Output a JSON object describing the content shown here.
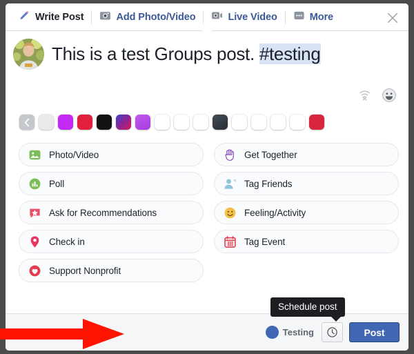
{
  "window": {
    "backdrop_color": "#4b4b4b",
    "surface_color": "#ffffff"
  },
  "tabs": [
    {
      "label": "Write Post",
      "icon": "pencil-icon",
      "active": true
    },
    {
      "label": "Add Photo/Video",
      "icon": "camera-icon",
      "active": false
    },
    {
      "label": "Live Video",
      "icon": "video-camera-icon",
      "active": false
    },
    {
      "label": "More",
      "icon": "ellipsis-icon",
      "active": false
    }
  ],
  "close_label": "×",
  "composer": {
    "avatar_name": "user-avatar",
    "text_plain": "This is a test Groups post. ",
    "text_hashtag": "#testing",
    "hashtag_highlight_color": "#d8e3f7",
    "utility_icons": [
      {
        "name": "live-off-icon"
      },
      {
        "name": "emoji-smiley-icon"
      }
    ]
  },
  "swatches": [
    {
      "name": "back-arrow",
      "type": "back",
      "color": "#c4c7cb"
    },
    {
      "name": "swatch-white-gray",
      "type": "solid",
      "color": "#e9eaec"
    },
    {
      "name": "swatch-magenta",
      "type": "solid",
      "color": "#c229f2"
    },
    {
      "name": "swatch-red",
      "type": "solid",
      "color": "#e0203c"
    },
    {
      "name": "swatch-black",
      "type": "solid",
      "color": "#121212"
    },
    {
      "name": "swatch-blue-pink-gradient",
      "type": "gradient",
      "color": "#4040c8",
      "color2": "#d1195e"
    },
    {
      "name": "swatch-purple-gradient",
      "type": "gradient",
      "color": "#b84ae8",
      "color2": "#c45bf0"
    },
    {
      "name": "swatch-plain-1",
      "type": "solid",
      "color": "#ffffff"
    },
    {
      "name": "swatch-plain-2",
      "type": "solid",
      "color": "#ffffff"
    },
    {
      "name": "swatch-plain-3",
      "type": "solid",
      "color": "#ffffff"
    },
    {
      "name": "swatch-dark-slate",
      "type": "gradient",
      "color": "#2b3138",
      "color2": "#414b55"
    },
    {
      "name": "swatch-plain-4",
      "type": "solid",
      "color": "#ffffff"
    },
    {
      "name": "swatch-plain-5",
      "type": "solid",
      "color": "#ffffff"
    },
    {
      "name": "swatch-plain-6",
      "type": "solid",
      "color": "#ffffff"
    },
    {
      "name": "swatch-plain-7",
      "type": "solid",
      "color": "#ffffff"
    },
    {
      "name": "swatch-crimson",
      "type": "solid",
      "color": "#d8263c"
    }
  ],
  "options": [
    {
      "label": "Photo/Video",
      "icon": "photo-icon",
      "color": "#7dbd58"
    },
    {
      "label": "Get Together",
      "icon": "hand-wave-icon",
      "color": "#8a4ec1"
    },
    {
      "label": "Poll",
      "icon": "poll-bars-icon",
      "color": "#7dbd58"
    },
    {
      "label": "Tag Friends",
      "icon": "tag-friends-icon",
      "color": "#8ec5dc"
    },
    {
      "label": "Ask for Recommendations",
      "icon": "recommendation-icon",
      "color": "#ea5167"
    },
    {
      "label": "Feeling/Activity",
      "icon": "feeling-icon",
      "color": "#f5c148"
    },
    {
      "label": "Check in",
      "icon": "location-pin-icon",
      "color": "#e8365f"
    },
    {
      "label": "Tag Event",
      "icon": "calendar-icon",
      "color": "#e23c4e"
    },
    {
      "label": "Support Nonprofit",
      "icon": "heart-shield-icon",
      "color": "#e23c4e"
    }
  ],
  "footer": {
    "audience_label": "Testing",
    "audience_icon": "audience-globe-icon",
    "schedule_icon": "clock-icon",
    "post_label": "Post",
    "post_button_color": "#4267b2"
  },
  "tooltip": {
    "text": "Schedule post",
    "background": "#1c1e21"
  },
  "annotation": {
    "arrow_color": "#fe1300",
    "name": "red-pointer-arrow"
  }
}
